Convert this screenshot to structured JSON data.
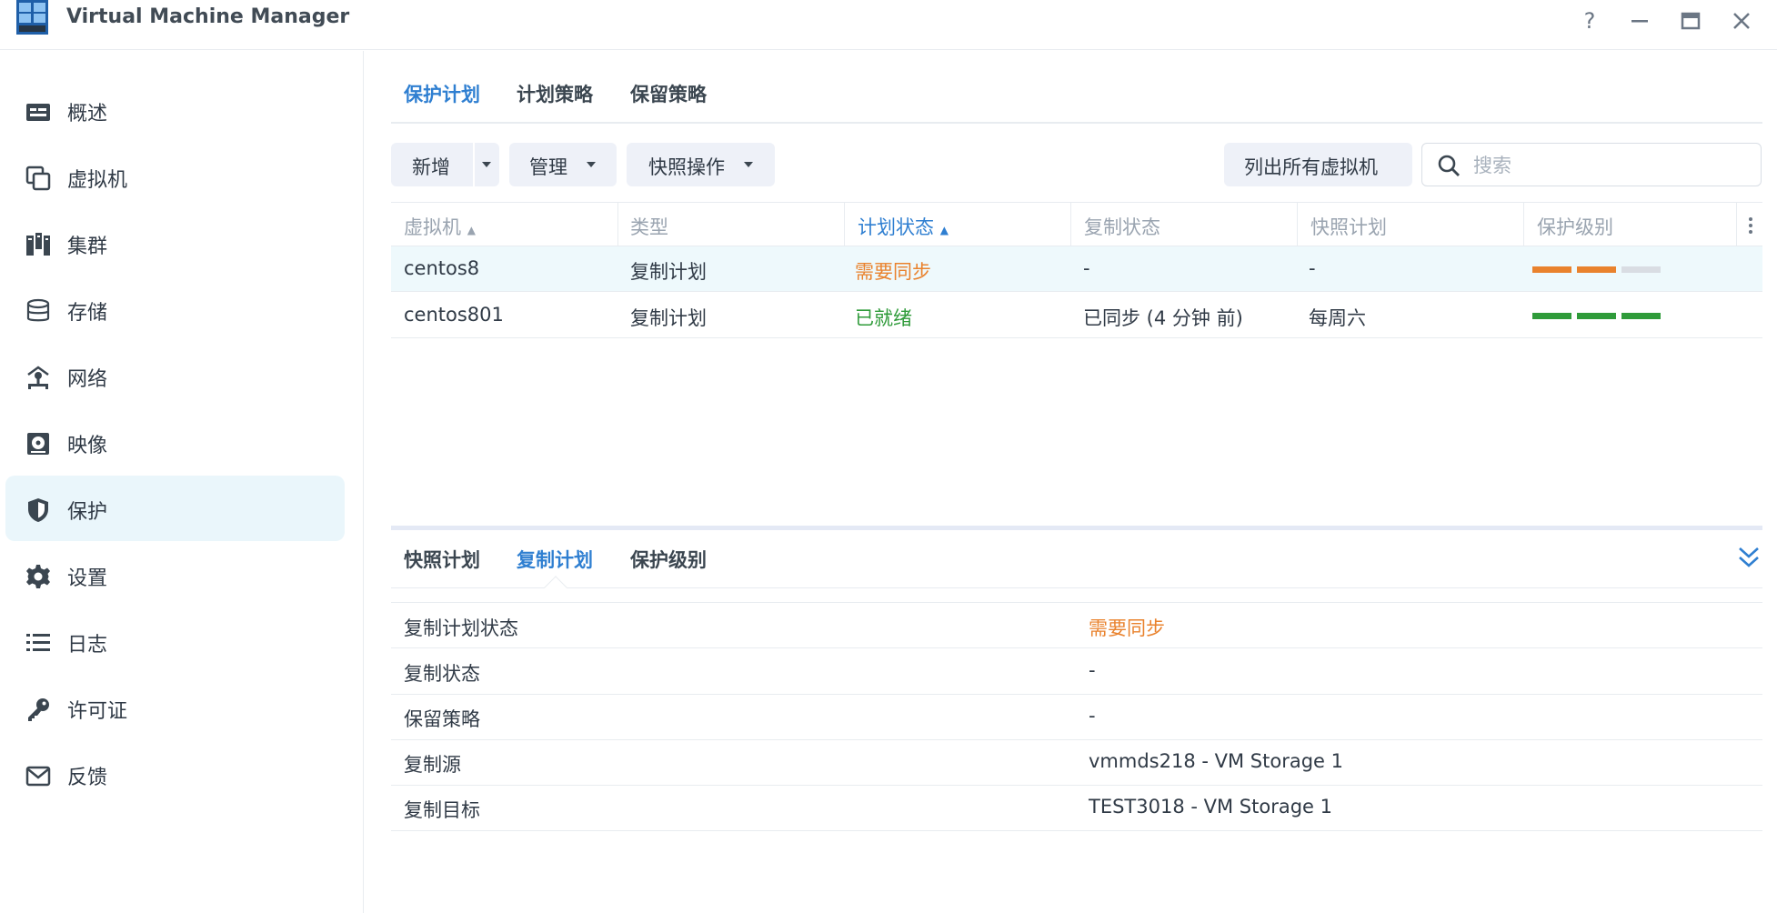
{
  "app": {
    "title": "Virtual Machine Manager",
    "icon": "vmm-grid-icon",
    "window_buttons": {
      "help": "?",
      "minimize": "—",
      "maximize": "□",
      "close": "✕"
    }
  },
  "sidebar": {
    "items": [
      {
        "label": "概述",
        "icon": "overview-card-icon",
        "active": false
      },
      {
        "label": "虚拟机",
        "icon": "virtual-machine-icon",
        "active": false
      },
      {
        "label": "集群",
        "icon": "cluster-icon",
        "active": false
      },
      {
        "label": "存储",
        "icon": "storage-cylinder-icon",
        "active": false
      },
      {
        "label": "网络",
        "icon": "network-icon",
        "active": false
      },
      {
        "label": "映像",
        "icon": "image-disc-icon",
        "active": false
      },
      {
        "label": "保护",
        "icon": "shield-icon",
        "active": true
      },
      {
        "label": "设置",
        "icon": "gear-icon",
        "active": false
      },
      {
        "label": "日志",
        "icon": "list-icon",
        "active": false
      },
      {
        "label": "许可证",
        "icon": "key-icon",
        "active": false
      },
      {
        "label": "反馈",
        "icon": "mail-icon",
        "active": false
      }
    ]
  },
  "main": {
    "tabs": [
      {
        "label": "保护计划",
        "active": true
      },
      {
        "label": "计划策略",
        "active": false
      },
      {
        "label": "保留策略",
        "active": false
      }
    ],
    "toolbar": {
      "add_label": "新增",
      "manage_label": "管理",
      "snapshot_ops_label": "快照操作",
      "list_all_label": "列出所有虚拟机",
      "search_placeholder": "搜索",
      "search_value": ""
    },
    "grid": {
      "columns": [
        "虚拟机",
        "类型",
        "计划状态",
        "复制状态",
        "快照计划",
        "保护级别"
      ],
      "sorted_column": "计划状态",
      "rows": [
        {
          "vm": "centos8",
          "type": "复制计划",
          "plan_status": "需要同步",
          "plan_status_kind": "warning",
          "replication_status": "-",
          "snapshot_plan": "-",
          "protection_level": 2,
          "protection_color": "#e9822d",
          "selected": true
        },
        {
          "vm": "centos801",
          "type": "复制计划",
          "plan_status": "已就绪",
          "plan_status_kind": "ok",
          "replication_status": "已同步 (4 分钟 前)",
          "snapshot_plan": "每周六",
          "protection_level": 3,
          "protection_color": "#2f9b3a",
          "selected": false
        }
      ]
    }
  },
  "detail": {
    "tabs": [
      {
        "label": "快照计划",
        "active": false
      },
      {
        "label": "复制计划",
        "active": true
      },
      {
        "label": "保护级别",
        "active": false
      }
    ],
    "properties": [
      {
        "key": "复制计划状态",
        "value": "需要同步",
        "kind": "warning"
      },
      {
        "key": "复制状态",
        "value": "-",
        "kind": "normal"
      },
      {
        "key": "保留策略",
        "value": "-",
        "kind": "normal"
      },
      {
        "key": "复制源",
        "value": "vmmds218 - VM Storage 1",
        "kind": "normal"
      },
      {
        "key": "复制目标",
        "value": "TEST3018 - VM Storage 1",
        "kind": "normal"
      }
    ]
  },
  "colors": {
    "accent": "#2f7fd1",
    "warning": "#e9822d",
    "ok": "#2f9b3a",
    "inactive_segment": "#d9dde3",
    "active_nav_bg": "#eaf6fb"
  }
}
